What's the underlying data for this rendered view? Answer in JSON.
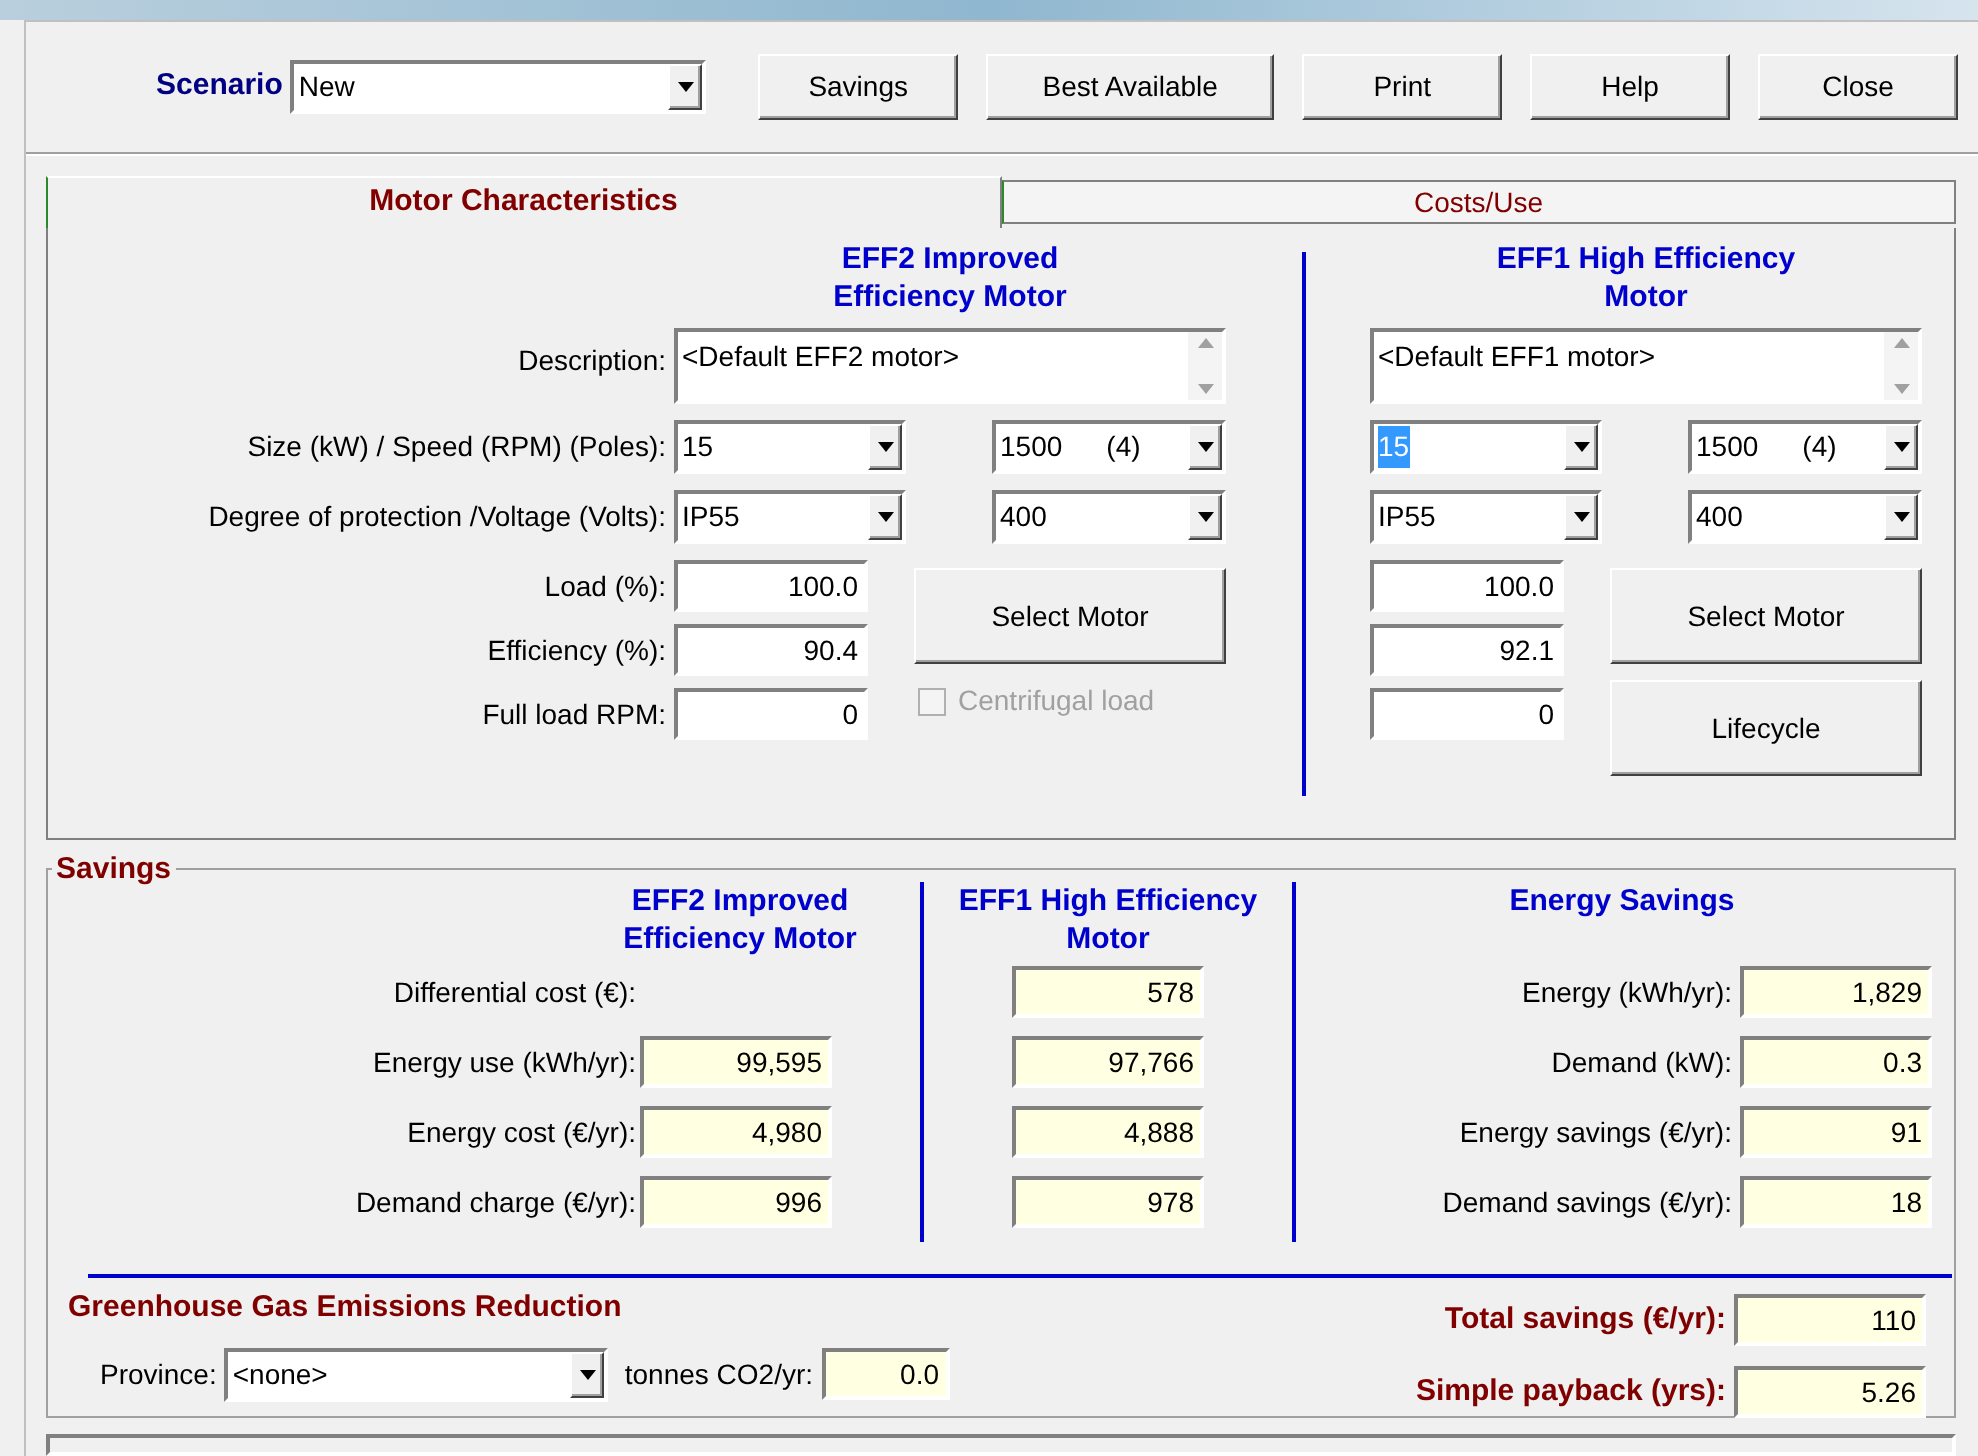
{
  "scenario": {
    "label": "Scenario",
    "value": "New"
  },
  "toolbar_buttons": [
    "Savings",
    "Best Available",
    "Print",
    "Help",
    "Close"
  ],
  "tabs": [
    {
      "label": "Motor Characteristics",
      "selected": true
    },
    {
      "label": "Costs/Use",
      "selected": false
    }
  ],
  "motor": {
    "row_labels": [
      "Description:",
      "Size (kW) / Speed (RPM) (Poles):",
      "Degree of protection /Voltage (Volts):",
      "Load (%):",
      "Efficiency (%):",
      "Full load RPM:"
    ],
    "columns": [
      {
        "title_lines": [
          "EFF2 Improved",
          "Efficiency Motor"
        ],
        "description": "<Default EFF2 motor>",
        "size": "15",
        "size_selected": false,
        "speed": "1500",
        "poles": "(4)",
        "protection": "IP55",
        "voltage": "400",
        "load": "100.0",
        "efficiency": "90.4",
        "full_load_rpm": "0",
        "buttons": [
          "Select Motor"
        ],
        "checkbox": {
          "label": "Centrifugal load",
          "checked": false,
          "disabled": true
        }
      },
      {
        "title_lines": [
          "EFF1 High Efficiency",
          "Motor"
        ],
        "description": "<Default EFF1 motor>",
        "size": "15",
        "size_selected": true,
        "speed": "1500",
        "poles": "(4)",
        "protection": "IP55",
        "voltage": "400",
        "load": "100.0",
        "efficiency": "92.1",
        "full_load_rpm": "0",
        "buttons": [
          "Select Motor",
          "Lifecycle"
        ]
      }
    ]
  },
  "savings": {
    "title": "Savings",
    "column_titles": [
      [
        "EFF2 Improved",
        "Efficiency Motor"
      ],
      [
        "EFF1 High Efficiency",
        "Motor"
      ],
      [
        "Energy Savings"
      ]
    ],
    "rows": [
      {
        "label": "Differential cost (€):",
        "eff1": "578"
      },
      {
        "label": "Energy use (kWh/yr):",
        "eff2": "99,595",
        "eff1": "97,766"
      },
      {
        "label": "Energy cost (€/yr):",
        "eff2": "4,980",
        "eff1": "4,888"
      },
      {
        "label": "Demand charge (€/yr):",
        "eff2": "996",
        "eff1": "978"
      }
    ],
    "energy_savings": [
      {
        "label": "Energy (kWh/yr):",
        "value": "1,829"
      },
      {
        "label": "Demand (kW):",
        "value": "0.3"
      },
      {
        "label": "Energy savings (€/yr):",
        "value": "91"
      },
      {
        "label": "Demand savings (€/yr):",
        "value": "18"
      }
    ],
    "greenhouse": {
      "title": "Greenhouse Gas Emissions Reduction",
      "province_label": "Province:",
      "province": "<none>",
      "tonnes_label": "tonnes CO2/yr:",
      "tonnes": "0.0"
    },
    "totals": [
      {
        "label": "Total savings (€/yr):",
        "value": "110"
      },
      {
        "label": "Simple payback (yrs):",
        "value": "5.26"
      }
    ]
  }
}
